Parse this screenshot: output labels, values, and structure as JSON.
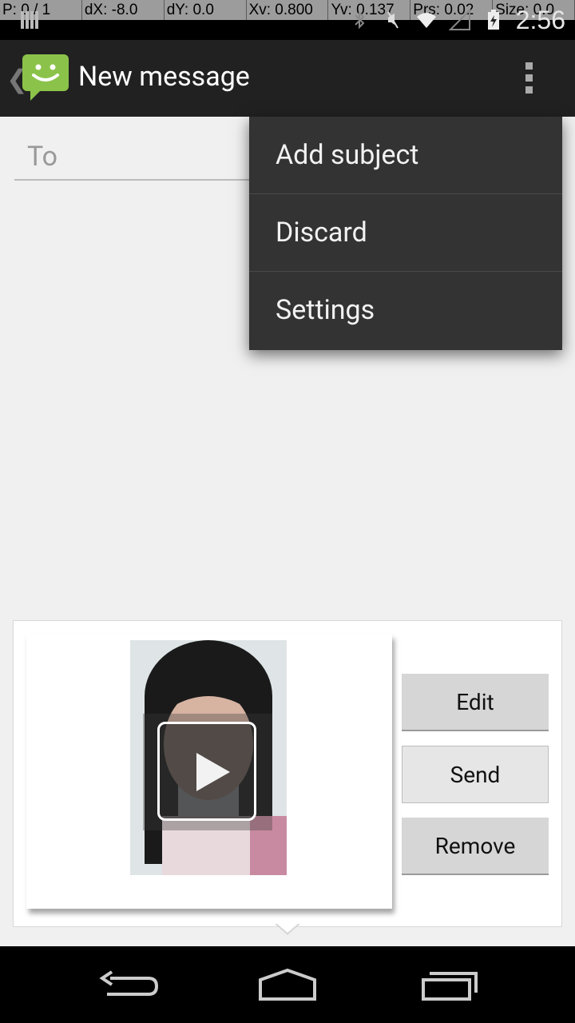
{
  "status_bar": {
    "debug": [
      "P: 0 / 1",
      "dX: -8.0",
      "dY: 0.0",
      "Xv: 0.800",
      "Yv: 0.137",
      "Prs: 0.02",
      "Size: 0.0"
    ],
    "time": "2:56"
  },
  "action_bar": {
    "title": "New message"
  },
  "compose": {
    "to_placeholder": "To"
  },
  "menu": {
    "items": [
      "Add subject",
      "Discard",
      "Settings"
    ]
  },
  "attachment": {
    "buttons": [
      "Edit",
      "Send",
      "Remove"
    ]
  },
  "colors": {
    "action_bar": "#212121",
    "menu_bg": "#333333",
    "logo_green": "#8bc34a"
  }
}
